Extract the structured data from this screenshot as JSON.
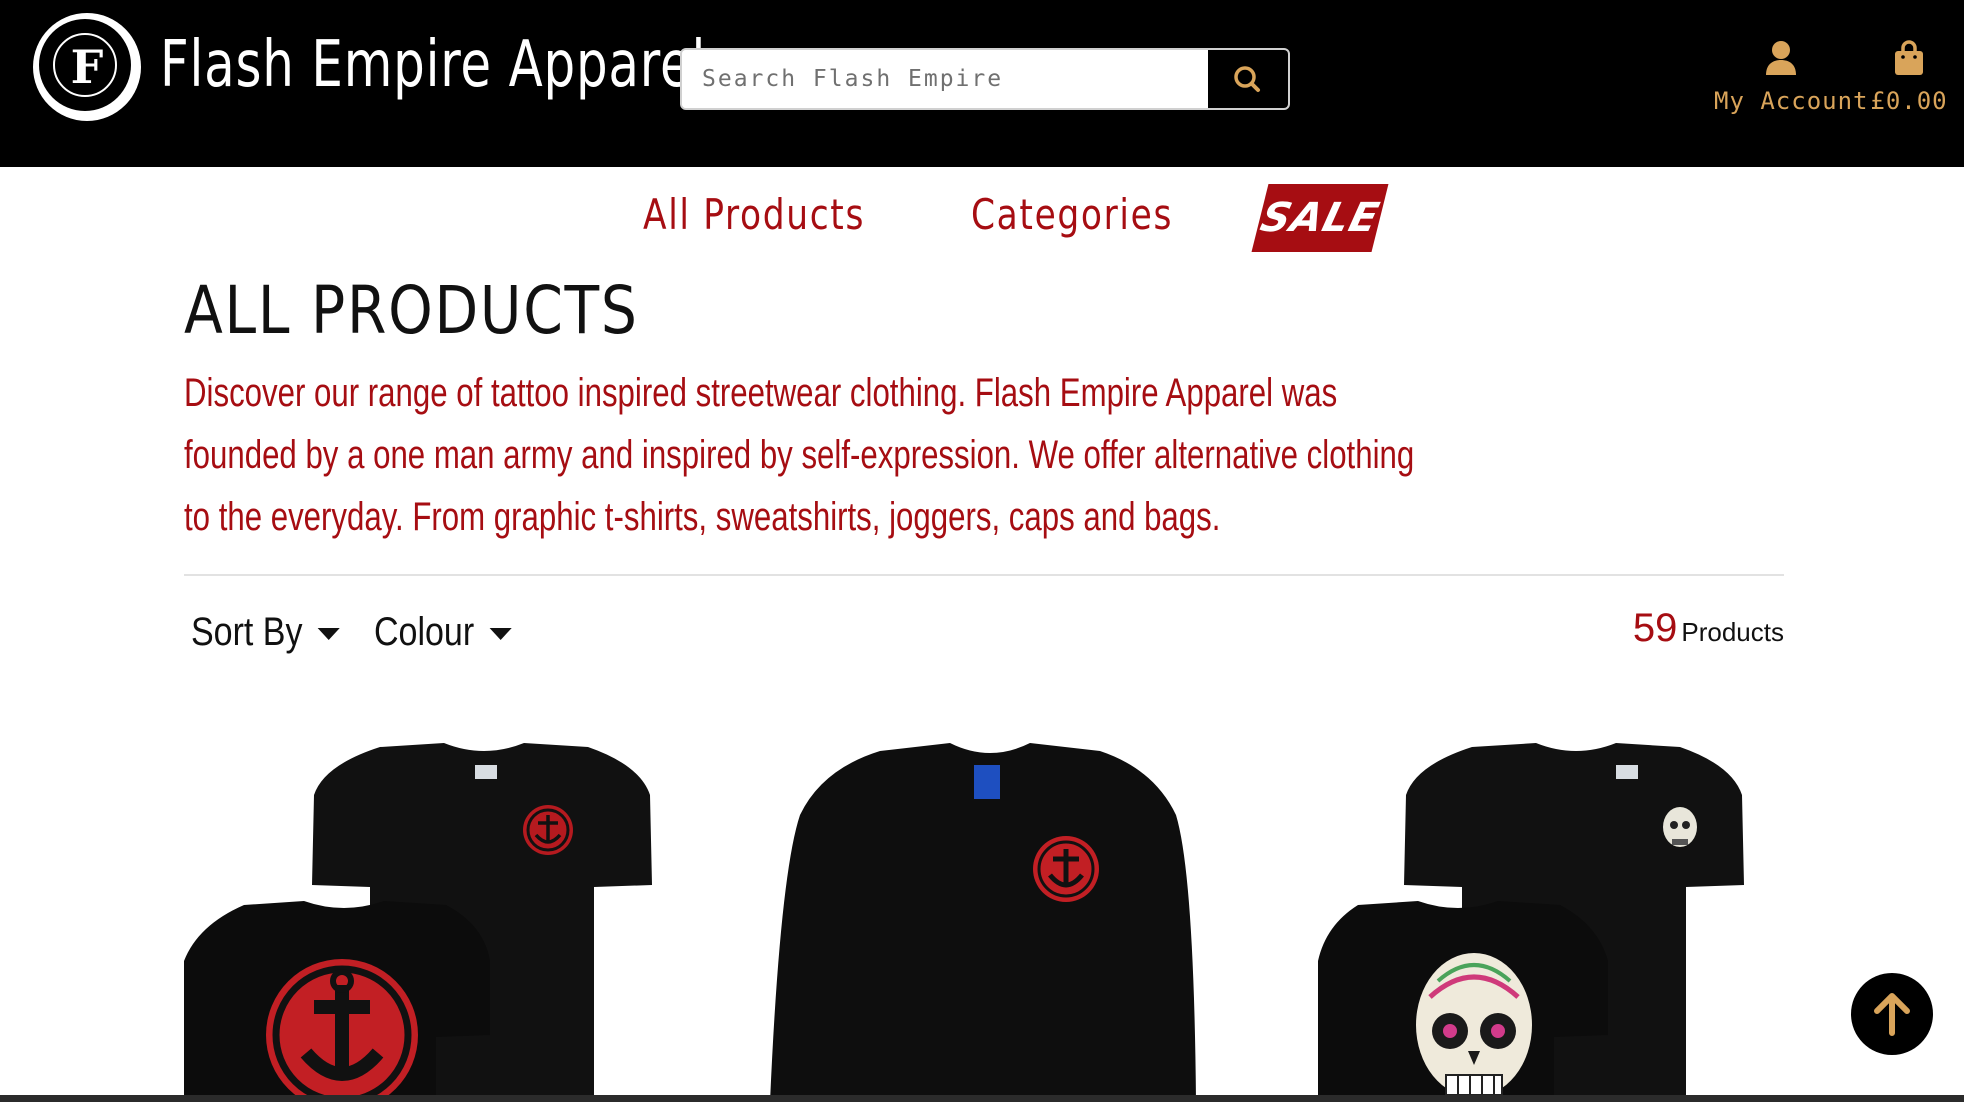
{
  "header": {
    "brand": "Flash Empire Apparel",
    "logo_letter": "F",
    "search_placeholder": "Search Flash Empire",
    "account_label": "My Account",
    "cart_total": "£0.00"
  },
  "nav": {
    "items": [
      "All Products",
      "Categories"
    ],
    "sale_label": "SALE"
  },
  "page": {
    "title": "ALL PRODUCTS",
    "intro": "Discover our range of tattoo inspired streetwear clothing. Flash Empire Apparel was founded by a one man army and inspired by self-expression. We offer alternative clothing to the everyday. From graphic t-shirts, sweatshirts, joggers, caps and bags."
  },
  "filters": {
    "sort_label": "Sort By",
    "colour_label": "Colour",
    "count": "59",
    "count_label": "Products"
  },
  "colors": {
    "brand_red": "#a60d12",
    "gold": "#d9a45a",
    "black": "#000000"
  },
  "icons": [
    "search-icon",
    "user-icon",
    "bag-icon",
    "arrow-up-icon",
    "chevron-down-icon"
  ]
}
